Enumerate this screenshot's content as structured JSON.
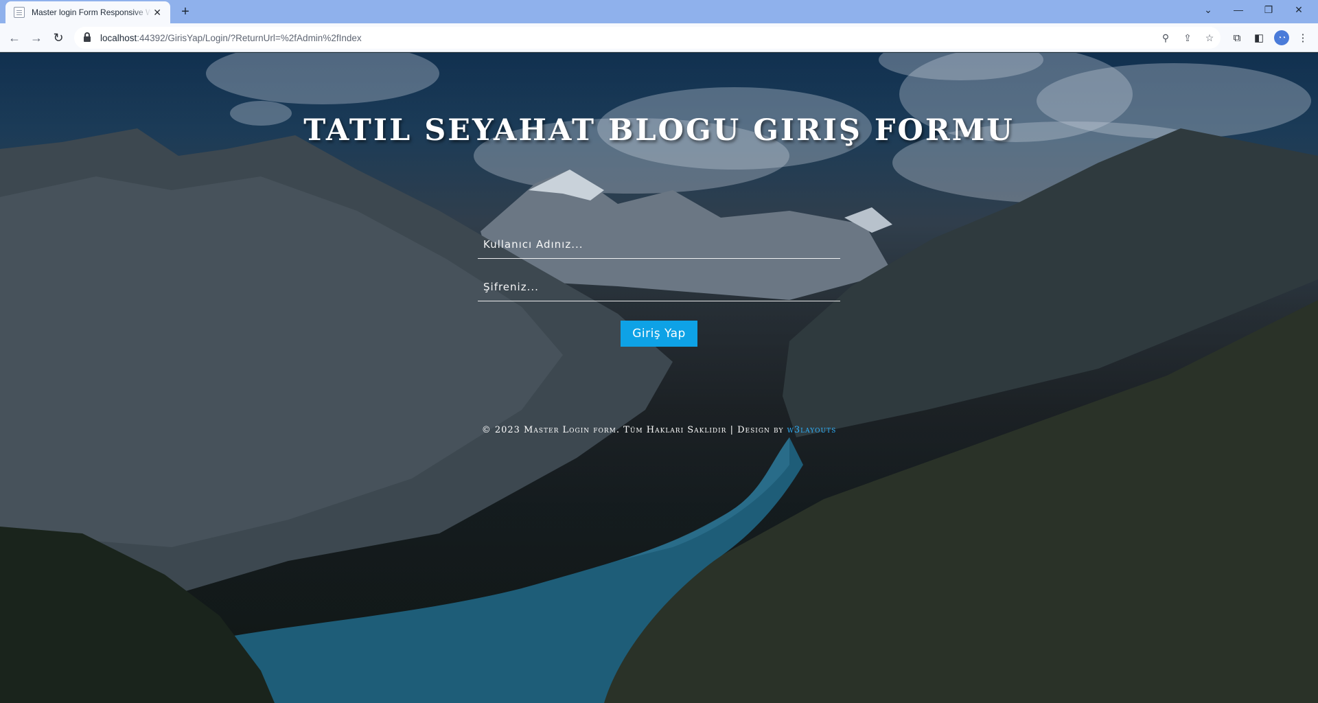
{
  "browser": {
    "tab": {
      "title": "Master login Form Responsive W",
      "close_icon": "close-icon",
      "favicon": "page-icon"
    },
    "new_tab_label": "+",
    "window_controls": [
      "chevron-down-icon",
      "minimize-icon",
      "restore-icon",
      "close-icon"
    ],
    "nav": [
      "back-arrow-icon",
      "forward-arrow-icon",
      "reload-icon"
    ],
    "address": {
      "host": "localhost",
      "rest": ":44392/GirisYap/Login/?ReturnUrl=%2fAdmin%2fIndex"
    },
    "omnibox_icons": [
      "zoom-icon",
      "share-icon",
      "star-icon"
    ],
    "toolbar_icons": [
      "extensions-icon",
      "side-panel-icon",
      "profile-avatar",
      "kebab-menu-icon"
    ]
  },
  "page": {
    "heading": "TATIL SEYAHAT BLOGU GIRIŞ FORMU",
    "username_placeholder": "Kullanıcı Adınız...",
    "password_placeholder": "Şifreniz...",
    "submit_label": "Giriş Yap",
    "footer_text": "© 2023 Master Login form. Tüm Hakları Saklıdır | Design by",
    "footer_link": "w3layouts",
    "colors": {
      "button": "#0ea2e6",
      "link": "#2fb3ff",
      "tabbar": "#8fb1ec"
    }
  }
}
